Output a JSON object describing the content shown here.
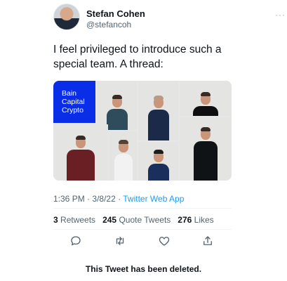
{
  "user": {
    "name": "Stefan Cohen",
    "handle": "@stefancoh"
  },
  "tweet": {
    "line1": "I feel privileged to introduce such a",
    "line2": "special team. A thread:",
    "time": "1:36 PM",
    "date": "3/8/22",
    "source": "Twitter Web App"
  },
  "media": {
    "brand_lines": [
      "Bain",
      "Capital",
      "Crypto"
    ]
  },
  "stats": {
    "retweets_count": "3",
    "retweets_label": "Retweets",
    "quotes_count": "245",
    "quotes_label": "Quote Tweets",
    "likes_count": "276",
    "likes_label": "Likes"
  },
  "actions": {
    "icons": [
      "reply-icon",
      "retweet-icon",
      "like-icon",
      "share-icon"
    ]
  },
  "status": {
    "deleted": "This Tweet has been deleted."
  },
  "colors": {
    "link": "#1d9bf0",
    "brand": "#0a2ee8",
    "muted": "#536471"
  }
}
